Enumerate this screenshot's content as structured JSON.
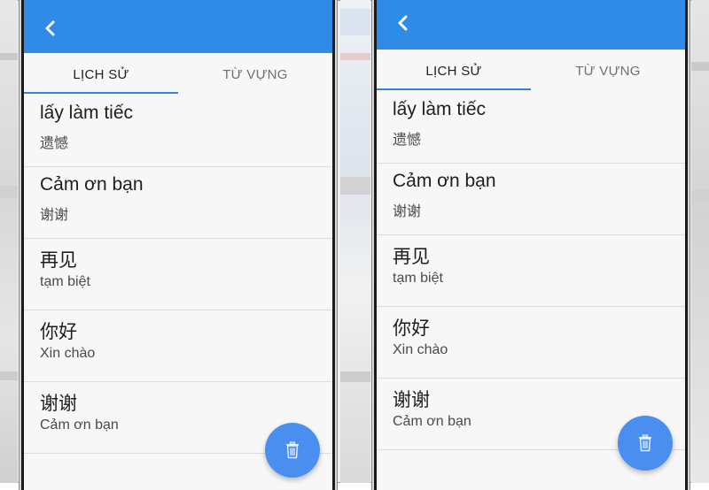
{
  "colors": {
    "appbar": "#2f8be6",
    "tab_indicator": "#3a7fdc",
    "fab": "#4a8ff0"
  },
  "screens": [
    {
      "tabs": [
        "LỊCH SỬ",
        "TỪ VỰNG"
      ],
      "active_tab": "LỊCH SỬ",
      "back_icon": "chevron-left-icon",
      "fab_icon": "trash-icon",
      "items": [
        {
          "main": "lấy làm tiếc",
          "sub": "遗憾"
        },
        {
          "main": "Cảm ơn bạn",
          "sub": "谢谢"
        },
        {
          "main": "再见",
          "sub": "tạm biệt"
        },
        {
          "main": "你好",
          "sub": "Xin chào"
        },
        {
          "main": "谢谢",
          "sub": "Cảm ơn bạn"
        }
      ]
    },
    {
      "tabs": [
        "LỊCH SỬ",
        "TỪ VỰNG"
      ],
      "active_tab": "LỊCH SỬ",
      "back_icon": "chevron-left-icon",
      "fab_icon": "trash-icon",
      "items": [
        {
          "main": "lấy làm tiếc",
          "sub": "遗憾"
        },
        {
          "main": "Cảm ơn bạn",
          "sub": "谢谢"
        },
        {
          "main": "再见",
          "sub": "tạm biệt"
        },
        {
          "main": "你好",
          "sub": "Xin chào"
        },
        {
          "main": "谢谢",
          "sub": "Cảm ơn bạn"
        }
      ]
    }
  ]
}
